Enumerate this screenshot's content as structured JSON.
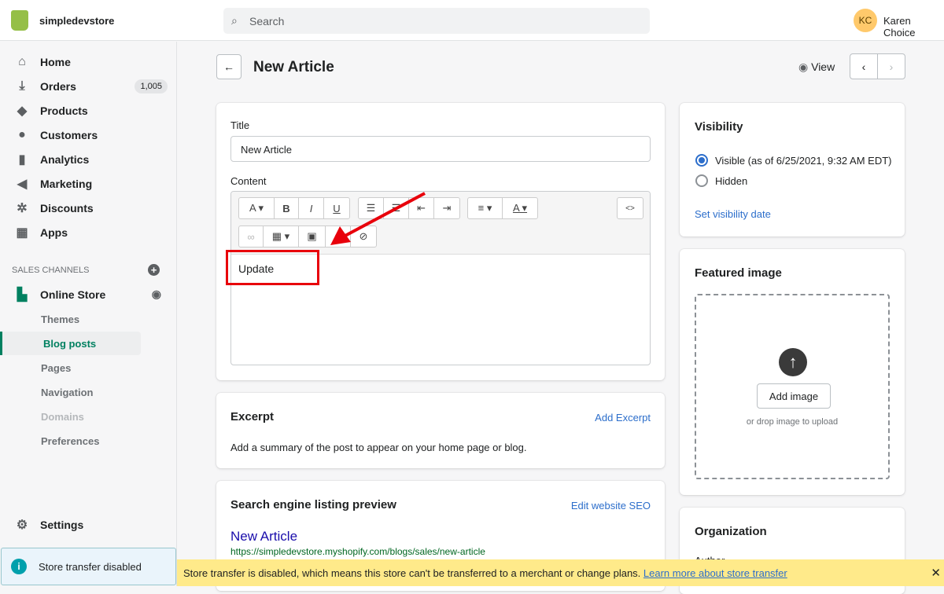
{
  "topbar": {
    "store_name": "simpledevstore",
    "search_placeholder": "Search",
    "avatar_initials": "KC",
    "user_name": "Karen Choice"
  },
  "sidebar": {
    "items": [
      {
        "label": "Home",
        "icon": "⌂"
      },
      {
        "label": "Orders",
        "icon": "⤓",
        "badge": "1,005"
      },
      {
        "label": "Products",
        "icon": "◆"
      },
      {
        "label": "Customers",
        "icon": "●"
      },
      {
        "label": "Analytics",
        "icon": "▮"
      },
      {
        "label": "Marketing",
        "icon": "◀"
      },
      {
        "label": "Discounts",
        "icon": "✲"
      },
      {
        "label": "Apps",
        "icon": "▦"
      }
    ],
    "sales_channels": "SALES CHANNELS",
    "online_store": "Online Store",
    "sub_items": [
      "Themes",
      "Blog posts",
      "Pages",
      "Navigation",
      "Domains",
      "Preferences"
    ],
    "settings": "Settings",
    "transfer": "Store transfer disabled"
  },
  "page": {
    "title": "New Article",
    "view": "View"
  },
  "article": {
    "title_label": "Title",
    "title_value": "New Article",
    "content_label": "Content",
    "content_text": "Update"
  },
  "excerpt": {
    "heading": "Excerpt",
    "action": "Add Excerpt",
    "description": "Add a summary of the post to appear on your home page or blog."
  },
  "seo": {
    "heading": "Search engine listing preview",
    "action": "Edit website SEO",
    "preview_title": "New Article",
    "preview_url": "https://simpledevstore.myshopify.com/blogs/sales/new-article"
  },
  "visibility": {
    "heading": "Visibility",
    "options": [
      "Visible (as of 6/25/2021, 9:32 AM EDT)",
      "Hidden"
    ],
    "set_date": "Set visibility date"
  },
  "featured": {
    "heading": "Featured image",
    "button": "Add image",
    "hint": "or drop image to upload"
  },
  "organization": {
    "heading": "Organization",
    "author": "Author"
  },
  "banner": {
    "text": "Store transfer is disabled, which means this store can't be transferred to a merchant or change plans. ",
    "link": "Learn more about store transfer"
  }
}
